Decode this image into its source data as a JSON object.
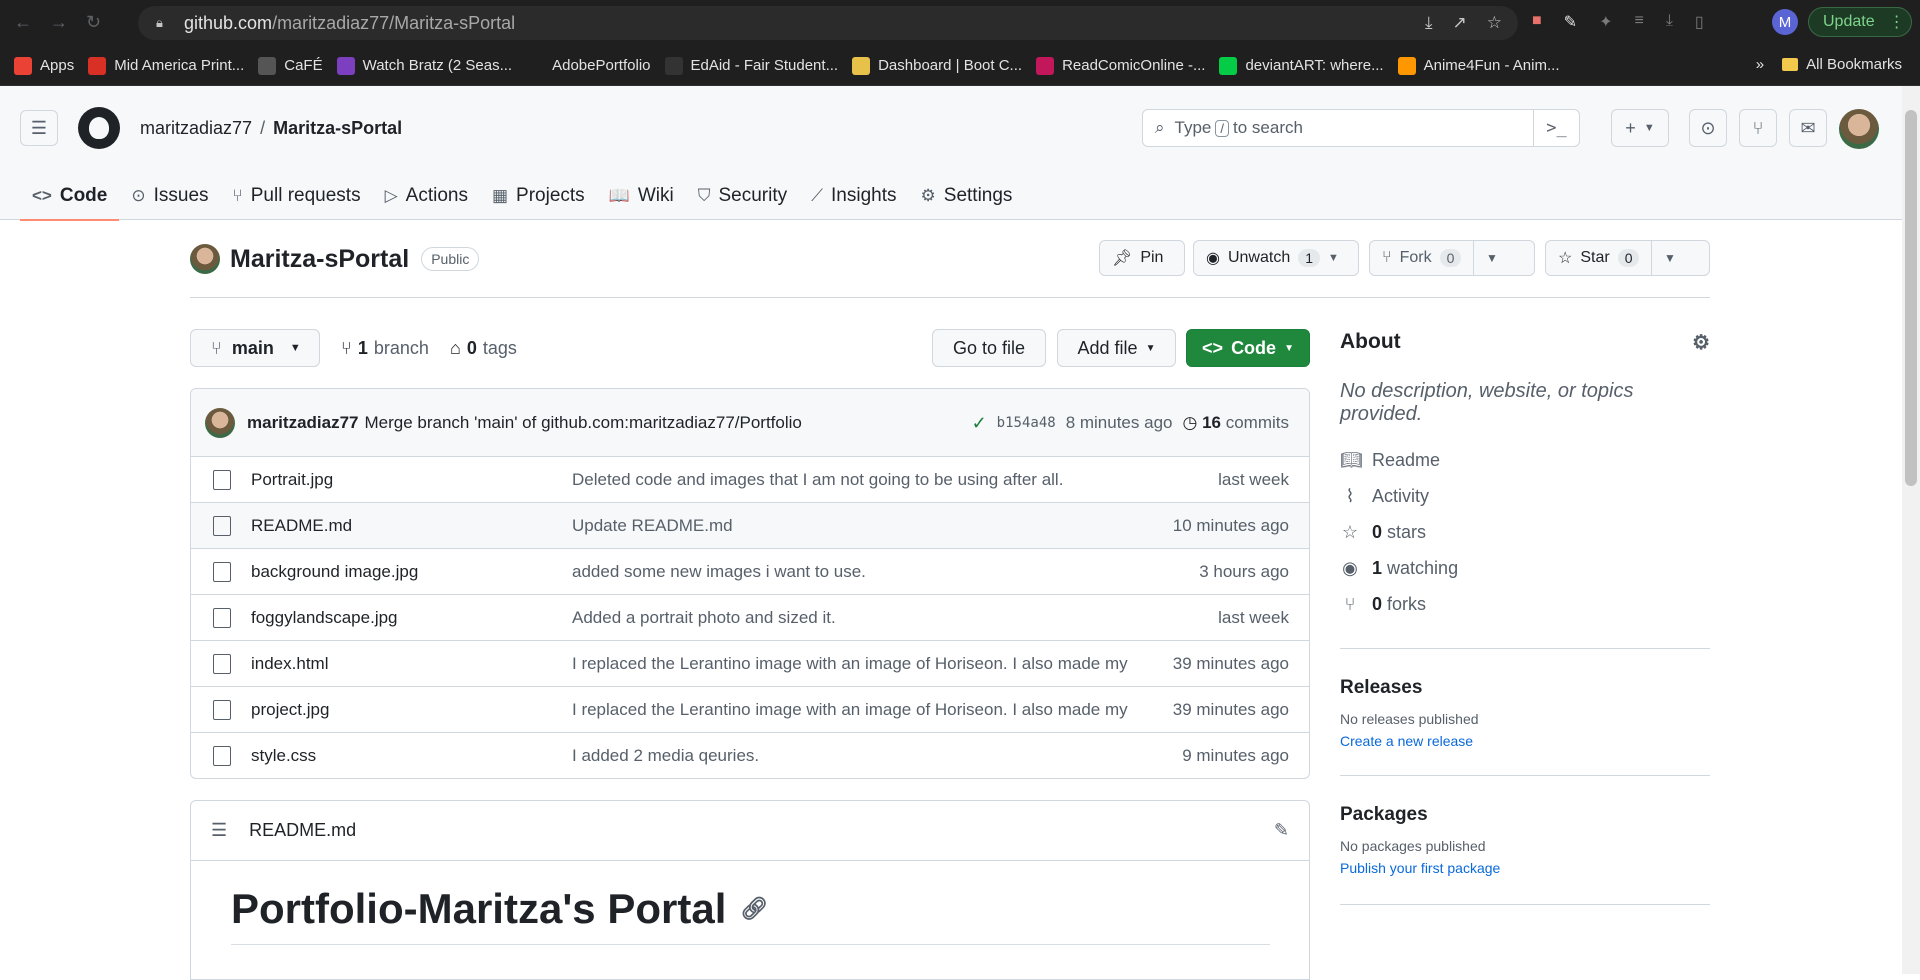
{
  "browser": {
    "url_host": "github.com",
    "url_path": "/maritzadiaz77/Maritza-sPortal",
    "profile_initial": "M",
    "update_label": "Update"
  },
  "bookmarks": [
    {
      "label": "Apps",
      "color": "#ea4335"
    },
    {
      "label": "Mid America Print...",
      "color": "#d93025"
    },
    {
      "label": "CaFÉ",
      "color": "#555555"
    },
    {
      "label": "Watch Bratz (2 Seas...",
      "color": "#7b3fbf"
    },
    {
      "label": "AdobePortfolio",
      "color": "#1f1f1f"
    },
    {
      "label": "EdAid - Fair Student...",
      "color": "#333333"
    },
    {
      "label": "Dashboard | Boot C...",
      "color": "#e8c14a"
    },
    {
      "label": "ReadComicOnline -...",
      "color": "#c2185b"
    },
    {
      "label": "deviantART: where...",
      "color": "#05cc47"
    },
    {
      "label": "Anime4Fun - Anim...",
      "color": "#ff9800"
    }
  ],
  "bookmarks_right": {
    "all": "All Bookmarks"
  },
  "header": {
    "owner": "maritzadiaz77",
    "separator": "/",
    "repo": "Maritza-sPortal",
    "search_prefix": "Type",
    "search_key": "/",
    "search_suffix": "to search"
  },
  "tabs": [
    {
      "label": "Code",
      "icon": "code-icon",
      "glyph": "<>"
    },
    {
      "label": "Issues",
      "icon": "issue-icon",
      "glyph": "⊙"
    },
    {
      "label": "Pull requests",
      "icon": "pull-request-icon",
      "glyph": "⑂"
    },
    {
      "label": "Actions",
      "icon": "play-icon",
      "glyph": "▷"
    },
    {
      "label": "Projects",
      "icon": "table-icon",
      "glyph": "▦"
    },
    {
      "label": "Wiki",
      "icon": "book-icon",
      "glyph": "📖"
    },
    {
      "label": "Security",
      "icon": "shield-icon",
      "glyph": "⛉"
    },
    {
      "label": "Insights",
      "icon": "graph-icon",
      "glyph": "⟋"
    },
    {
      "label": "Settings",
      "icon": "gear-icon",
      "glyph": "⚙"
    }
  ],
  "repo": {
    "name": "Maritza-sPortal",
    "visibility": "Public",
    "pin": "Pin",
    "unwatch": "Unwatch",
    "watch_count": "1",
    "fork": "Fork",
    "fork_count": "0",
    "star": "Star",
    "star_count": "0"
  },
  "toolbar": {
    "branch": "main",
    "branches_count": "1",
    "branches_label": "branch",
    "tags_count": "0",
    "tags_label": "tags",
    "go_to_file": "Go to file",
    "add_file": "Add file",
    "code": "Code"
  },
  "commit": {
    "author": "maritzadiaz77",
    "message": "Merge branch 'main' of github.com:maritzadiaz77/Portfolio",
    "sha": "b154a48",
    "time": "8 minutes ago",
    "commits_count": "16",
    "commits_label": "commits"
  },
  "files": [
    {
      "name": "Portrait.jpg",
      "message": "Deleted code and images that I am not going to be using after all.",
      "time": "last week"
    },
    {
      "name": "README.md",
      "message": "Update README.md",
      "time": "10 minutes ago"
    },
    {
      "name": "background image.jpg",
      "message": "added some new images i want to use.",
      "time": "3 hours ago"
    },
    {
      "name": "foggylandscape.jpg",
      "message": "Added a portrait photo and sized it.",
      "time": "last week"
    },
    {
      "name": "index.html",
      "message": "I replaced the Lerantino image with an image of Horiseon. I also made my",
      "time": "39 minutes ago"
    },
    {
      "name": "project.jpg",
      "message": "I replaced the Lerantino image with an image of Horiseon. I also made my",
      "time": "39 minutes ago"
    },
    {
      "name": "style.css",
      "message": "I added 2 media qeuries.",
      "time": "9 minutes ago"
    }
  ],
  "readme": {
    "filename": "README.md",
    "heading": "Portfolio-Maritza's Portal"
  },
  "about": {
    "title": "About",
    "description": "No description, website, or topics provided.",
    "readme": "Readme",
    "activity": "Activity",
    "stars_count": "0",
    "stars_label": "stars",
    "watching_count": "1",
    "watching_label": "watching",
    "forks_count": "0",
    "forks_label": "forks"
  },
  "releases": {
    "title": "Releases",
    "none": "No releases published",
    "link": "Create a new release"
  },
  "packages": {
    "title": "Packages",
    "none": "No packages published",
    "link": "Publish your first package"
  }
}
